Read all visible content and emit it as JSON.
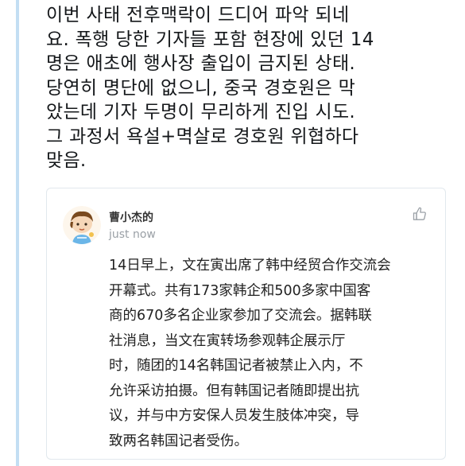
{
  "tweet": {
    "lines": [
      "이번 사태 전후맥락이 드디어 파악 되네",
      "요. 폭행 당한 기자들 포함 현장에 있던 14",
      "명은 애초에 행사장 출입이 금지된 상태.",
      "당연히 명단에 없으니, 중국 경호원은 막",
      "았는데 기자 두명이 무리하게 진입 시도.",
      "그 과정서 욕설+멱살로 경호원 위협하다",
      "맞음."
    ]
  },
  "quote": {
    "author": "曹小杰的",
    "time": "just now",
    "like_icon": "thumbs-up-icon",
    "lines": [
      "14日早上，文在寅出席了韩中经贸合作交流会",
      "开幕式。共有173家韩企和500多家中国客",
      "商的670多名企业家参加了交流会。据韩联",
      "社消息，当文在寅转场参观韩企展示厅",
      "时，随团的14名韩国记者被禁止入内，不",
      "允许采访拍摄。但有韩国记者随即提出抗",
      "议，并与中方安保人员发生肢体冲突，导",
      "致两名韩国记者受伤。"
    ]
  },
  "colors": {
    "thread_line": "#c3def3",
    "card_border": "#e1e8ed",
    "muted_text": "#9aa0a6"
  }
}
